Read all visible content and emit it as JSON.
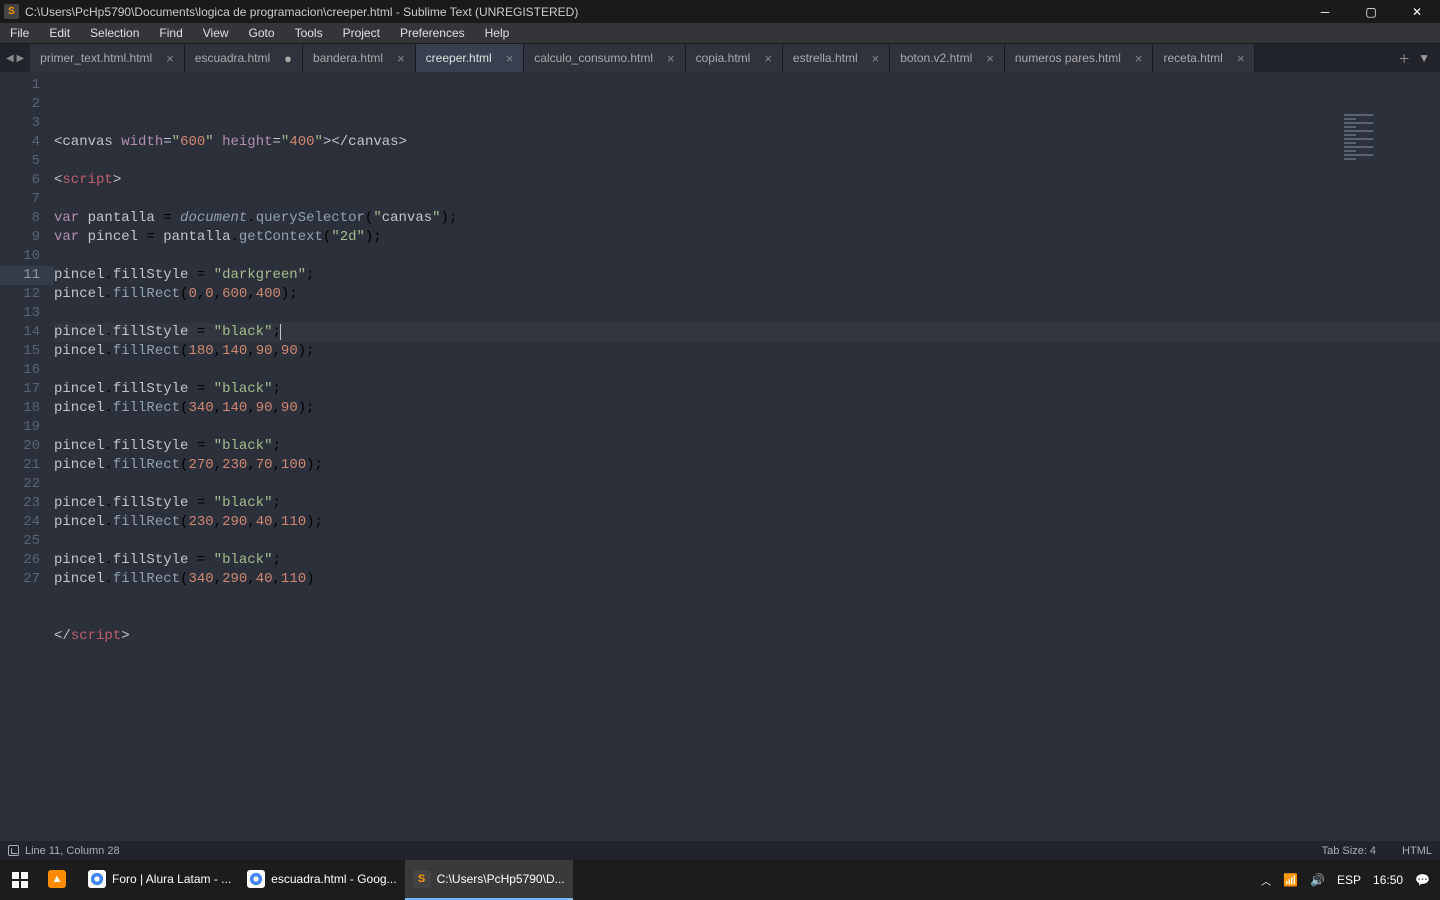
{
  "titlebar": {
    "title": "C:\\Users\\PcHp5790\\Documents\\logica de programacion\\creeper.html - Sublime Text (UNREGISTERED)"
  },
  "menubar": [
    "File",
    "Edit",
    "Selection",
    "Find",
    "View",
    "Goto",
    "Tools",
    "Project",
    "Preferences",
    "Help"
  ],
  "tabs": [
    {
      "label": "primer_text.html.html",
      "active": false,
      "dirty": false
    },
    {
      "label": "escuadra.html",
      "active": false,
      "dirty": true
    },
    {
      "label": "bandera.html",
      "active": false,
      "dirty": false
    },
    {
      "label": "creeper.html",
      "active": true,
      "dirty": false
    },
    {
      "label": "calculo_consumo.html",
      "active": false,
      "dirty": false
    },
    {
      "label": "copia.html",
      "active": false,
      "dirty": false
    },
    {
      "label": "estrella.html",
      "active": false,
      "dirty": false
    },
    {
      "label": "boton.v2.html",
      "active": false,
      "dirty": false
    },
    {
      "label": "numeros pares.html",
      "active": false,
      "dirty": false
    },
    {
      "label": "receta.html",
      "active": false,
      "dirty": false
    }
  ],
  "code": {
    "total_lines": 27,
    "highlight_line": 11,
    "lines": [
      "<canvas width=\"600\" height=\"400\"></canvas>",
      "",
      "<script>",
      "",
      "var pantalla = document.querySelector(\"canvas\");",
      "var pincel = pantalla.getContext(\"2d\");",
      "",
      "pincel.fillStyle = \"darkgreen\";",
      "pincel.fillRect(0,0,600,400);",
      "",
      "pincel.fillStyle = \"black\";",
      "pincel.fillRect(180,140,90,90);",
      "",
      "pincel.fillStyle = \"black\";",
      "pincel.fillRect(340,140,90,90);",
      "",
      "pincel.fillStyle = \"black\";",
      "pincel.fillRect(270,230,70,100);",
      "",
      "pincel.fillStyle = \"black\";",
      "pincel.fillRect(230,290,40,110);",
      "",
      "pincel.fillStyle = \"black\";",
      "pincel.fillRect(340,290,40,110)",
      "",
      "",
      "</script>"
    ]
  },
  "statusbar": {
    "position": "Line 11, Column 28",
    "tabsize": "Tab Size: 4",
    "syntax": "HTML"
  },
  "taskbar": {
    "items": [
      {
        "icon": "start",
        "label": ""
      },
      {
        "icon": "vlc",
        "label": ""
      },
      {
        "icon": "chrome",
        "label": "Foro | Alura Latam - ..."
      },
      {
        "icon": "chrome",
        "label": "escuadra.html - Goog..."
      },
      {
        "icon": "sublime",
        "label": "C:\\Users\\PcHp5790\\D...",
        "active": true
      }
    ],
    "tray": {
      "lang": "ESP",
      "time": "16:50"
    }
  }
}
